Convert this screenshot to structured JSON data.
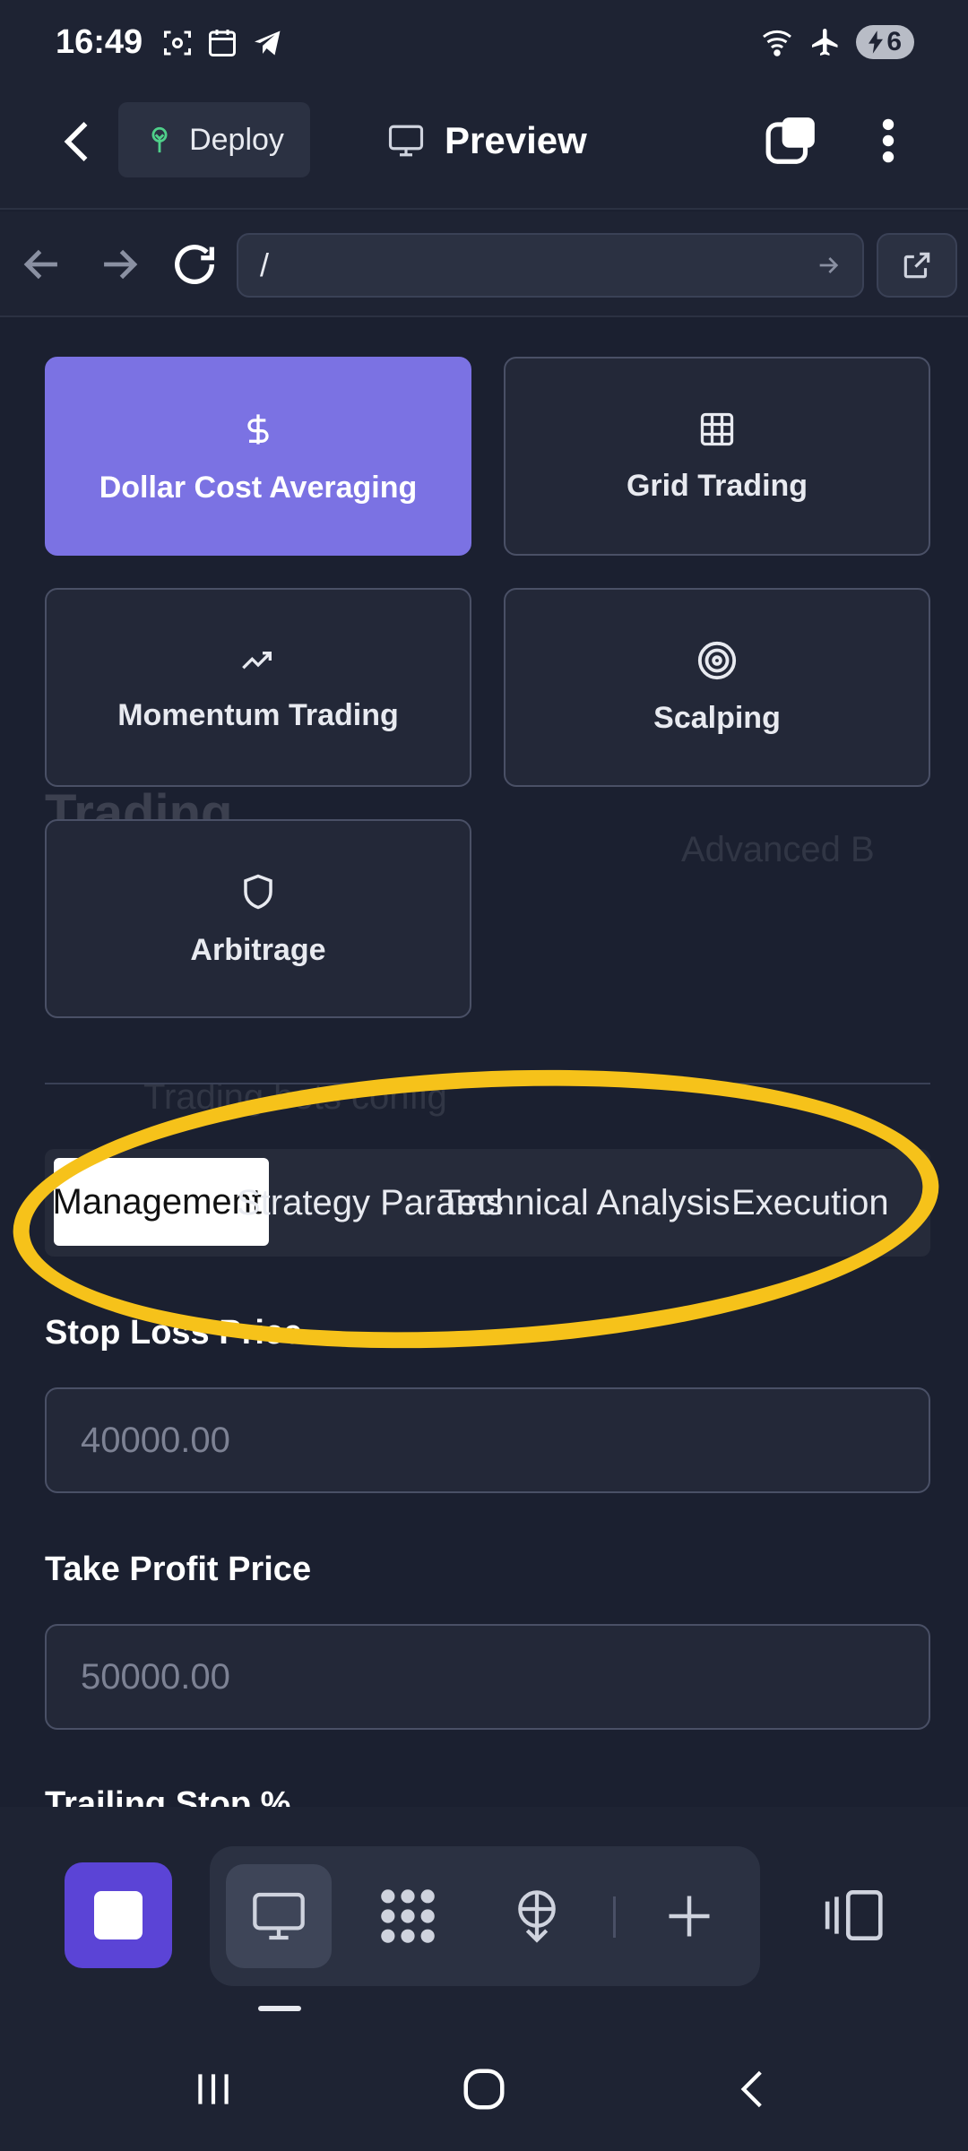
{
  "status_bar": {
    "time": "16:49",
    "battery": "6"
  },
  "app_bar": {
    "deploy_label": "Deploy",
    "preview_label": "Preview"
  },
  "url_bar": {
    "url": "/"
  },
  "strategies": [
    {
      "label": "Dollar Cost Averaging",
      "icon": "dollar-icon",
      "active": true
    },
    {
      "label": "Grid Trading",
      "icon": "grid-icon",
      "active": false
    },
    {
      "label": "Momentum Trading",
      "icon": "trending-up-icon",
      "active": false
    },
    {
      "label": "Scalping",
      "icon": "target-icon",
      "active": false
    },
    {
      "label": "Arbitrage",
      "icon": "shield-icon",
      "active": false
    }
  ],
  "tabs": [
    {
      "label": "Risk Management",
      "selected": true
    },
    {
      "label": "Strategy Params",
      "selected": false
    },
    {
      "label": "Technical Analysis",
      "selected": false
    },
    {
      "label": "Execution",
      "selected": false
    }
  ],
  "form": {
    "stop_loss_label": "Stop Loss Price",
    "stop_loss_placeholder": "40000.00",
    "take_profit_label": "Take Profit Price",
    "take_profit_placeholder": "50000.00",
    "trailing_stop_label": "Trailing Stop %"
  },
  "background_ghost": {
    "heading": "Trading",
    "button": "Advanced B",
    "subheading": "Trading bots config"
  },
  "colors": {
    "accent": "#7b72e3",
    "highlight_ring": "#f6c21a",
    "stop_button": "#5b44d6"
  }
}
